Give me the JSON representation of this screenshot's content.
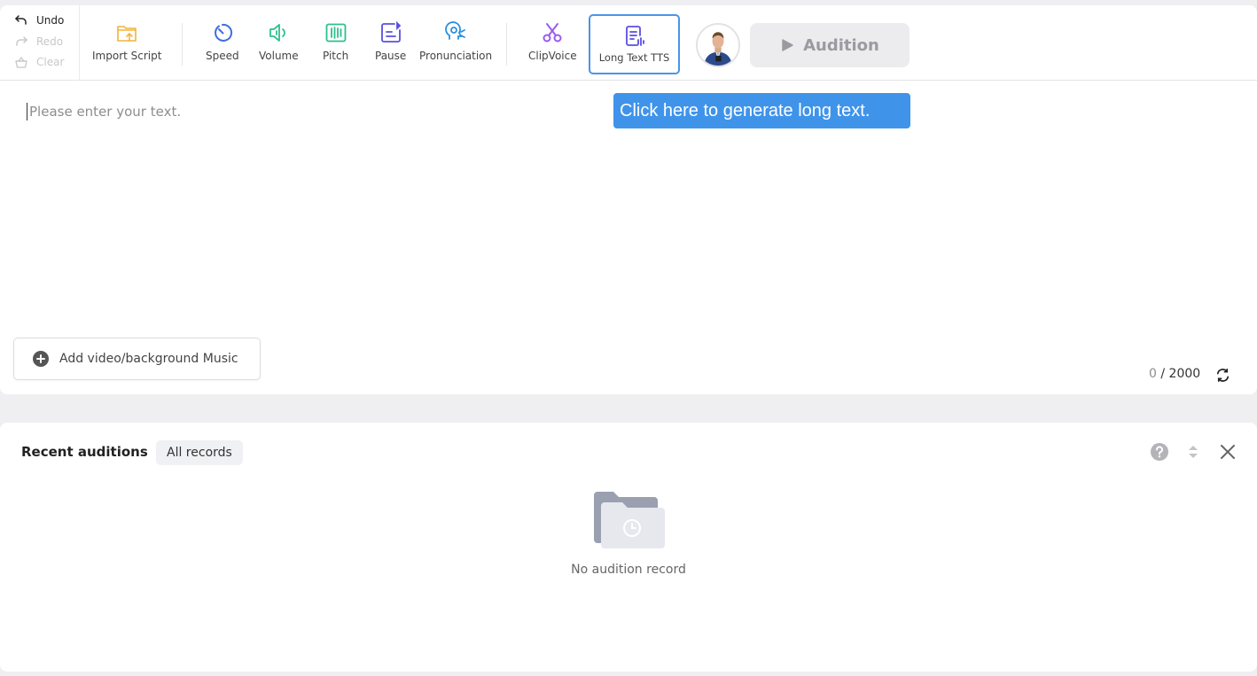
{
  "history": {
    "undo": "Undo",
    "redo": "Redo",
    "clear": "Clear"
  },
  "toolbar": {
    "import_script": "Import Script",
    "speed": "Speed",
    "volume": "Volume",
    "pitch": "Pitch",
    "pause": "Pause",
    "pronunciation": "Pronunciation",
    "clipvoice": "ClipVoice",
    "long_text_tts": "Long Text TTS",
    "audition": "Audition"
  },
  "colors": {
    "import": "#f2b33d",
    "speed": "#3d6fe0",
    "volume": "#2fbf8e",
    "pitch": "#2fbf8e",
    "pause": "#5a4fe0",
    "pronunciation": "#2a8fe0",
    "clipvoice": "#9a5af0",
    "long_text": "#5a4fe0",
    "tooltip_bg": "#3f94ea",
    "highlight_border": "#4a95e8"
  },
  "editor": {
    "placeholder": "Please enter your text.",
    "tooltip": "Click here to generate long text.",
    "add_music": "Add video/background Music",
    "char_count": "0",
    "char_limit": "/ 2000"
  },
  "records": {
    "title": "Recent auditions",
    "filter": "All records",
    "empty": "No audition record"
  }
}
